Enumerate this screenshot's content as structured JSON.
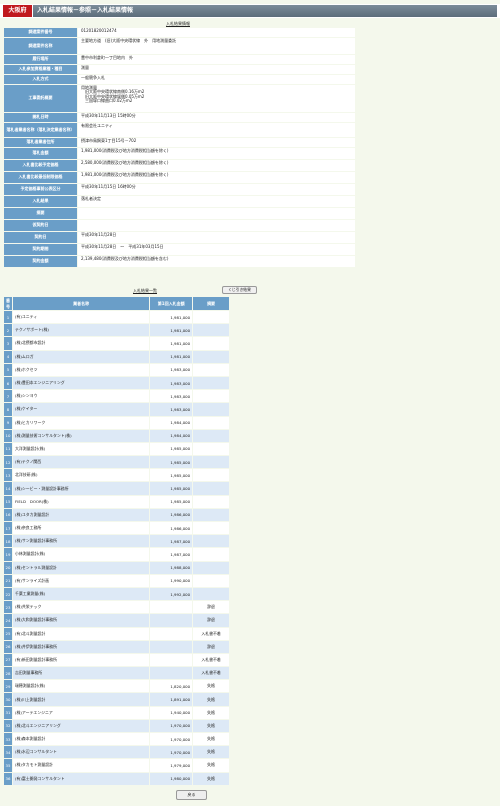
{
  "header": {
    "logo": "大阪府",
    "breadcrumb": "入札結果情報－参照－入札結果情報"
  },
  "detail": {
    "subtitle": "入札結果情報",
    "rows": [
      {
        "label": "調達案件番号",
        "value": "01201820012474"
      },
      {
        "label": "調達案件名称",
        "value": "主要地方道　(旧)大阪中央環状線　外　用地測量委託"
      },
      {
        "label": "履行場所",
        "value": "豊中市利倉町一丁目地内　外"
      },
      {
        "label": "入札参加資格業種・種目",
        "value": "測量"
      },
      {
        "label": "入札方式",
        "value": "一般競争入札"
      },
      {
        "label": "工事委託概要",
        "value": "用地測量\n　旧大阪中央環状線南側0.16万m2\n　旧大阪中央環状線塚側0.05万m2\n　三国塚口線曲口0.02万m2"
      },
      {
        "label": "開札日時",
        "value": "平成30年11月13日 15時00分"
      },
      {
        "label": "落札者業者名称（落札決定業者名称）",
        "value": "有限会社ユニティ"
      },
      {
        "label": "落札者業者住所",
        "value": "摂津市鳥飼東1丁目15号－702"
      },
      {
        "label": "落札金額",
        "value": "1,981,000(消費税及び地方消費税相当額を除く)"
      },
      {
        "label": "入札書比較予定価格",
        "value": "2,580,000(消費税及び地方消費税相当額を除く)"
      },
      {
        "label": "入札書比較最低制限価格",
        "value": "1,981,000(消費税及び地方消費税相当額を除く)"
      },
      {
        "label": "予定価格事前公表区分",
        "value": "平成30年11月15日 16時00分"
      },
      {
        "label": "入札結果",
        "value": "落札者決定"
      },
      {
        "label": "摘要",
        "value": ""
      },
      {
        "label": "仮契約日",
        "value": ""
      },
      {
        "label": "契約日",
        "value": "平成30年11月28日"
      },
      {
        "label": "契約期間",
        "value": "平成30年11月28日　～　平成31年03月15日"
      },
      {
        "label": "契約金額",
        "value": "2,139,480(消費税及び地方消費税相当額を含む)"
      }
    ]
  },
  "bid_list": {
    "title": "入札結果一覧",
    "lottery_button": "くじ引き結果",
    "headers": {
      "no": "番号",
      "name": "業者名称",
      "amount": "第1回入札金額",
      "note": "摘要"
    },
    "rows": [
      {
        "no": "1",
        "name": "(有)ユニティ",
        "amount": "1,981,000",
        "note": ""
      },
      {
        "no": "2",
        "name": "テクノサポート(株)",
        "amount": "1,981,000",
        "note": ""
      },
      {
        "no": "3",
        "name": "(株)北摂都市設計",
        "amount": "1,981,000",
        "note": ""
      },
      {
        "no": "4",
        "name": "(株)ムロガ",
        "amount": "1,981,000",
        "note": ""
      },
      {
        "no": "5",
        "name": "(株)ホクセツ",
        "amount": "1,983,000",
        "note": ""
      },
      {
        "no": "6",
        "name": "(株)豊田本エンジニアリング",
        "amount": "1,983,000",
        "note": ""
      },
      {
        "no": "7",
        "name": "(株)シンヨウ",
        "amount": "1,983,000",
        "note": ""
      },
      {
        "no": "8",
        "name": "(株)ケイター",
        "amount": "1,983,000",
        "note": ""
      },
      {
        "no": "9",
        "name": "(株)ヒカリワーク",
        "amount": "1,984,000",
        "note": ""
      },
      {
        "no": "10",
        "name": "(株)測量技術コンサルタント(株)",
        "amount": "1,984,000",
        "note": ""
      },
      {
        "no": "11",
        "name": "大洋測量設計(株)",
        "amount": "1,985,000",
        "note": ""
      },
      {
        "no": "12",
        "name": "(有)テクノ関西",
        "amount": "1,985,000",
        "note": ""
      },
      {
        "no": "13",
        "name": "北洋技研(株)",
        "amount": "1,985,000",
        "note": ""
      },
      {
        "no": "14",
        "name": "(株)シービー・測量設計事務所",
        "amount": "1,985,000",
        "note": ""
      },
      {
        "no": "15",
        "name": "FIELD　DOOR(株)",
        "amount": "1,985,000",
        "note": ""
      },
      {
        "no": "16",
        "name": "(株)ユタカ測量設計",
        "amount": "1,986,000",
        "note": ""
      },
      {
        "no": "17",
        "name": "(株)奈良工務所",
        "amount": "1,986,000",
        "note": ""
      },
      {
        "no": "18",
        "name": "(株)サン測量設計事務所",
        "amount": "1,987,000",
        "note": ""
      },
      {
        "no": "19",
        "name": "小林測量設計(株)",
        "amount": "1,987,000",
        "note": ""
      },
      {
        "no": "20",
        "name": "(株)セントラル測量設計",
        "amount": "1,988,000",
        "note": ""
      },
      {
        "no": "21",
        "name": "(有)サンライズ計画",
        "amount": "1,990,000",
        "note": ""
      },
      {
        "no": "22",
        "name": "千葉工業測量(株)",
        "amount": "1,992,000",
        "note": ""
      },
      {
        "no": "23",
        "name": "(株)共栄テック",
        "amount": "",
        "note": "辞退"
      },
      {
        "no": "24",
        "name": "(株)大和測量設計事務所",
        "amount": "",
        "note": "辞退"
      },
      {
        "no": "25",
        "name": "(有)北斗測量設計",
        "amount": "",
        "note": "入札書不着"
      },
      {
        "no": "26",
        "name": "(株)井伊測量設計事務所",
        "amount": "",
        "note": "辞退"
      },
      {
        "no": "27",
        "name": "(有)新田測量設計事務所",
        "amount": "",
        "note": "入札書不着"
      },
      {
        "no": "28",
        "name": "吉田測量事務所",
        "amount": "",
        "note": "入札書不着"
      },
      {
        "no": "29",
        "name": "瑞穂測量設計(株)",
        "amount": "1,820,000",
        "note": "失格"
      },
      {
        "no": "30",
        "name": "(株)川上測量設計",
        "amount": "1,891,000",
        "note": "失格"
      },
      {
        "no": "31",
        "name": "(株)アーテエンジニア",
        "amount": "1,940,000",
        "note": "失格"
      },
      {
        "no": "32",
        "name": "(株)北斗エンジニアリング",
        "amount": "1,970,000",
        "note": "失格"
      },
      {
        "no": "33",
        "name": "(株)森本測量設計",
        "amount": "1,970,000",
        "note": "失格"
      },
      {
        "no": "34",
        "name": "(株)水辺コンサルタント",
        "amount": "1,970,000",
        "note": "失格"
      },
      {
        "no": "35",
        "name": "(株)タカモト測量設計",
        "amount": "1,979,000",
        "note": "失格"
      },
      {
        "no": "36",
        "name": "(有)富士開発コンサルタント",
        "amount": "1,980,000",
        "note": "失格"
      }
    ]
  },
  "footer": {
    "back_button": "戻る"
  },
  "colors": {
    "header_bg": "#6a9ec8",
    "row_alt": "#dde9f6",
    "logo_red": "#c0191e",
    "page_bg": "#f4f8ec"
  }
}
